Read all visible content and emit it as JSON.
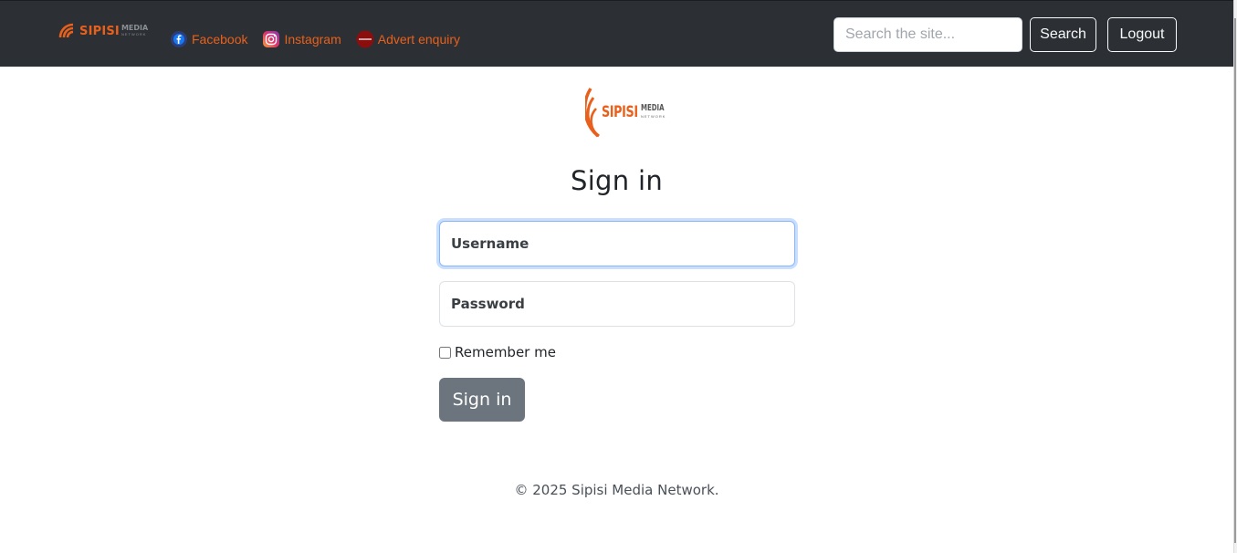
{
  "navbar": {
    "brand": {
      "name": "SIPISI",
      "sub1": "MEDIA",
      "sub2": "NETWORK"
    },
    "links": [
      {
        "label": "Facebook",
        "icon": "facebook-icon"
      },
      {
        "label": "Instagram",
        "icon": "instagram-icon"
      },
      {
        "label": "Advert enquiry",
        "icon": "advert-icon"
      }
    ],
    "search_placeholder": "Search the site...",
    "search_label": "Search",
    "logout_label": "Logout"
  },
  "main": {
    "logo": {
      "name": "SIPISI",
      "sub1": "MEDIA",
      "sub2": "NETWORK"
    },
    "title": "Sign in",
    "username_placeholder": "Username",
    "password_placeholder": "Password",
    "remember_label": "Remember me",
    "signin_label": "Sign in"
  },
  "footer": {
    "text": "© 2025 Sipisi Media Network."
  },
  "colors": {
    "navbar_bg": "#2c3034",
    "accent": "#e8601c",
    "button_secondary": "#6c757d"
  }
}
